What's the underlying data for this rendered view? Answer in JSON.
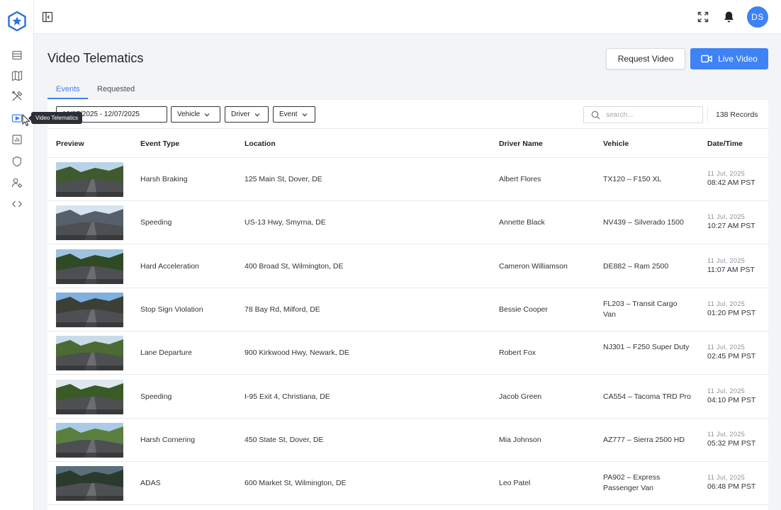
{
  "sidebar": {
    "tooltip": "Video Telematics",
    "items": [
      {
        "icon": "list-icon"
      },
      {
        "icon": "map-icon"
      },
      {
        "icon": "tools-icon"
      },
      {
        "icon": "video-play-icon"
      },
      {
        "icon": "bar-chart-icon"
      },
      {
        "icon": "shield-icon"
      },
      {
        "icon": "user-settings-icon"
      },
      {
        "icon": "code-icon"
      }
    ]
  },
  "topbar": {
    "avatar_initials": "DS"
  },
  "header": {
    "title": "Video Telematics",
    "request_button": "Request Video",
    "live_button": "Live Video"
  },
  "tabs": [
    {
      "label": "Events",
      "active": true
    },
    {
      "label": "Requested",
      "active": false
    }
  ],
  "filters": {
    "date_range": "10/07/2025 - 12/07/2025",
    "vehicle": "Vehicle",
    "driver": "Driver",
    "event": "Event",
    "search_placeholder": "search...",
    "records": "138 Records"
  },
  "table": {
    "columns": [
      "Preview",
      "Event Type",
      "Location",
      "Driver Name",
      "Vehicle",
      "Date/Time"
    ],
    "rows": [
      {
        "event_type": "Harsh Braking",
        "location": "125 Main St, Dover, DE",
        "driver": "Albert Flores",
        "vehicle": "TX120 – F150 XL",
        "date": "11 Jul, 2025",
        "time": "08:42 AM PST"
      },
      {
        "event_type": "Speeding",
        "location": "US-13 Hwy, Smyrna, DE",
        "driver": "Annette Black",
        "vehicle": "NV439 – Silverado 1500",
        "date": "11 Jul, 2025",
        "time": "10:27 AM PST"
      },
      {
        "event_type": "Hard Acceleration",
        "location": "400 Broad St, Wilmington, DE",
        "driver": "Cameron Williamson",
        "vehicle": "DE882 – Ram 2500",
        "date": "11 Jul, 2025",
        "time": "11:07 AM PST"
      },
      {
        "event_type": "Stop Sign Violation",
        "location": "78 Bay Rd, Milford, DE",
        "driver": "Bessie Cooper",
        "vehicle": "FL203 – Transit Cargo Van",
        "date": "11 Jul, 2025",
        "time": "01:20 PM PST"
      },
      {
        "event_type": "Lane Departure",
        "location": "900 Kirkwood Hwy, Newark, DE",
        "driver": "Robert Fox",
        "vehicle": "NJ301 – F250 Super Duty",
        "date": "11 Jul, 2025",
        "time": "02:45 PM PST"
      },
      {
        "event_type": "Speeding",
        "location": "I-95 Exit 4, Christiana, DE",
        "driver": "Jacob Green",
        "vehicle": "CA554 – Tacoma TRD Pro",
        "date": "11 Jul, 2025",
        "time": "04:10 PM PST"
      },
      {
        "event_type": "Harsh Cornering",
        "location": "450 State St, Dover, DE",
        "driver": "Mia Johnson",
        "vehicle": "AZ777 – Sierra 2500 HD",
        "date": "11 Jul, 2025",
        "time": "05:32 PM PST"
      },
      {
        "event_type": "ADAS",
        "location": "600 Market St, Wilmington, DE",
        "driver": "Leo Patel",
        "vehicle": "PA902 – Express Passenger Van",
        "date": "11 Jul, 2025",
        "time": "06:48 PM PST"
      }
    ]
  },
  "colors": {
    "accent": "#3f82f5",
    "brand_logo": "#2f6fe0"
  }
}
